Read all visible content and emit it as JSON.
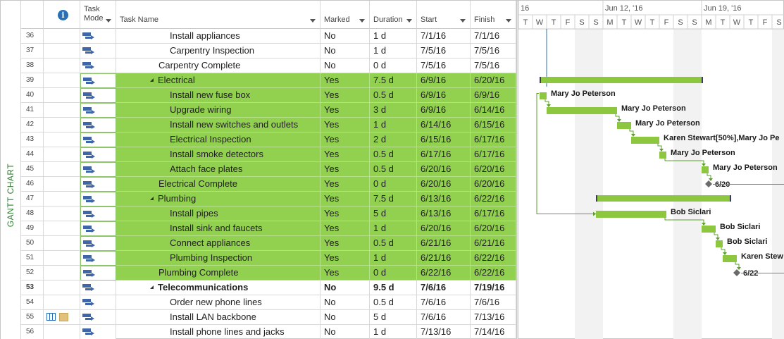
{
  "view": {
    "label": "GANTT CHART"
  },
  "columns": {
    "task_mode": "Task\nMode",
    "task_name": "Task Name",
    "marked": "Marked",
    "duration": "Duration",
    "start": "Start",
    "finish": "Finish"
  },
  "rows": [
    {
      "id": "36",
      "name": "Install appliances",
      "indent": 2,
      "marked": "No",
      "duration": "1 d",
      "start": "7/1/16",
      "finish": "7/1/16",
      "highlight": false,
      "summary": false
    },
    {
      "id": "37",
      "name": "Carpentry Inspection",
      "indent": 2,
      "marked": "No",
      "duration": "1 d",
      "start": "7/5/16",
      "finish": "7/5/16",
      "highlight": false,
      "summary": false
    },
    {
      "id": "38",
      "name": "Carpentry Complete",
      "indent": 1,
      "marked": "No",
      "duration": "0 d",
      "start": "7/5/16",
      "finish": "7/5/16",
      "highlight": false,
      "summary": false
    },
    {
      "id": "39",
      "name": "Electrical",
      "indent": 1,
      "marked": "Yes",
      "duration": "7.5 d",
      "start": "6/9/16",
      "finish": "6/20/16",
      "highlight": true,
      "summary": true,
      "bold": false
    },
    {
      "id": "40",
      "name": "Install new fuse box",
      "indent": 2,
      "marked": "Yes",
      "duration": "0.5 d",
      "start": "6/9/16",
      "finish": "6/9/16",
      "highlight": true,
      "summary": false
    },
    {
      "id": "41",
      "name": "Upgrade wiring",
      "indent": 2,
      "marked": "Yes",
      "duration": "3 d",
      "start": "6/9/16",
      "finish": "6/14/16",
      "highlight": true,
      "summary": false
    },
    {
      "id": "42",
      "name": "Install new switches and outlets",
      "indent": 2,
      "marked": "Yes",
      "duration": "1 d",
      "start": "6/14/16",
      "finish": "6/15/16",
      "highlight": true,
      "summary": false
    },
    {
      "id": "43",
      "name": "Electrical Inspection",
      "indent": 2,
      "marked": "Yes",
      "duration": "2 d",
      "start": "6/15/16",
      "finish": "6/17/16",
      "highlight": true,
      "summary": false
    },
    {
      "id": "44",
      "name": "Install smoke detectors",
      "indent": 2,
      "marked": "Yes",
      "duration": "0.5 d",
      "start": "6/17/16",
      "finish": "6/17/16",
      "highlight": true,
      "summary": false
    },
    {
      "id": "45",
      "name": "Attach face plates",
      "indent": 2,
      "marked": "Yes",
      "duration": "0.5 d",
      "start": "6/20/16",
      "finish": "6/20/16",
      "highlight": true,
      "summary": false
    },
    {
      "id": "46",
      "name": "Electrical Complete",
      "indent": 1,
      "marked": "Yes",
      "duration": "0 d",
      "start": "6/20/16",
      "finish": "6/20/16",
      "highlight": true,
      "summary": false
    },
    {
      "id": "47",
      "name": "Plumbing",
      "indent": 1,
      "marked": "Yes",
      "duration": "7.5 d",
      "start": "6/13/16",
      "finish": "6/22/16",
      "highlight": true,
      "summary": true,
      "bold": false
    },
    {
      "id": "48",
      "name": "Install pipes",
      "indent": 2,
      "marked": "Yes",
      "duration": "5 d",
      "start": "6/13/16",
      "finish": "6/17/16",
      "highlight": true,
      "summary": false
    },
    {
      "id": "49",
      "name": "Install sink and faucets",
      "indent": 2,
      "marked": "Yes",
      "duration": "1 d",
      "start": "6/20/16",
      "finish": "6/20/16",
      "highlight": true,
      "summary": false
    },
    {
      "id": "50",
      "name": "Connect appliances",
      "indent": 2,
      "marked": "Yes",
      "duration": "0.5 d",
      "start": "6/21/16",
      "finish": "6/21/16",
      "highlight": true,
      "summary": false
    },
    {
      "id": "51",
      "name": "Plumbing Inspection",
      "indent": 2,
      "marked": "Yes",
      "duration": "1 d",
      "start": "6/21/16",
      "finish": "6/22/16",
      "highlight": true,
      "summary": false
    },
    {
      "id": "52",
      "name": "Plumbing Complete",
      "indent": 1,
      "marked": "Yes",
      "duration": "0 d",
      "start": "6/22/16",
      "finish": "6/22/16",
      "highlight": true,
      "summary": false
    },
    {
      "id": "53",
      "name": "Telecommunications",
      "indent": 1,
      "marked": "No",
      "duration": "9.5 d",
      "start": "7/6/16",
      "finish": "7/19/16",
      "highlight": false,
      "summary": true,
      "bold": true
    },
    {
      "id": "54",
      "name": "Order new phone lines",
      "indent": 2,
      "marked": "No",
      "duration": "0.5 d",
      "start": "7/6/16",
      "finish": "7/6/16",
      "highlight": false,
      "summary": false
    },
    {
      "id": "55",
      "name": "Install LAN backbone",
      "indent": 2,
      "marked": "No",
      "duration": "5 d",
      "start": "7/6/16",
      "finish": "7/13/16",
      "highlight": false,
      "summary": false,
      "indicators": true
    },
    {
      "id": "56",
      "name": "Install phone lines and jacks",
      "indent": 2,
      "marked": "No",
      "duration": "1 d",
      "start": "7/13/16",
      "finish": "7/14/16",
      "highlight": false,
      "summary": false
    }
  ],
  "timescale": {
    "weeks": [
      {
        "label": "16",
        "day_index": -1
      },
      {
        "label": "Jun 12, '16",
        "day_index": 5
      },
      {
        "label": "Jun 19, '16",
        "day_index": 12
      }
    ],
    "days": [
      "T",
      "W",
      "T",
      "F",
      "S",
      "S",
      "M",
      "T",
      "W",
      "T",
      "F",
      "S",
      "S",
      "M",
      "T",
      "W",
      "T",
      "F",
      "S"
    ],
    "first_day": "6/7/16",
    "weekend_indices": [
      4,
      5,
      11,
      12,
      18
    ]
  },
  "gantt": {
    "bars": [
      {
        "row": 3,
        "type": "summary",
        "start_day": 1.5,
        "end_day": 13.1
      },
      {
        "row": 4,
        "type": "task",
        "start_day": 1.5,
        "end_day": 2.0,
        "label": "Mary Jo Peterson"
      },
      {
        "row": 5,
        "type": "task",
        "start_day": 2.0,
        "end_day": 7.0,
        "label": "Mary Jo Peterson"
      },
      {
        "row": 6,
        "type": "task",
        "start_day": 7.0,
        "end_day": 8.0,
        "label": "Mary Jo Peterson"
      },
      {
        "row": 7,
        "type": "task",
        "start_day": 8.0,
        "end_day": 10.0,
        "label": "Karen Stewart[50%],Mary Jo Pe"
      },
      {
        "row": 8,
        "type": "task",
        "start_day": 10.0,
        "end_day": 10.5,
        "label": "Mary Jo Peterson"
      },
      {
        "row": 9,
        "type": "task",
        "start_day": 13.0,
        "end_day": 13.5,
        "label": "Mary Jo Peterson"
      },
      {
        "row": 10,
        "type": "milestone",
        "start_day": 13.5,
        "label": "6/20"
      },
      {
        "row": 11,
        "type": "summary",
        "start_day": 5.5,
        "end_day": 15.1
      },
      {
        "row": 12,
        "type": "task",
        "start_day": 5.5,
        "end_day": 10.5,
        "label": "Bob Siclari"
      },
      {
        "row": 13,
        "type": "task",
        "start_day": 13.0,
        "end_day": 14.0,
        "label": "Bob Siclari"
      },
      {
        "row": 14,
        "type": "task",
        "start_day": 14.0,
        "end_day": 14.5,
        "label": "Bob Siclari"
      },
      {
        "row": 15,
        "type": "task",
        "start_day": 14.5,
        "end_day": 15.5,
        "label": "Karen Stew"
      },
      {
        "row": 16,
        "type": "milestone",
        "start_day": 15.5,
        "label": "6/22"
      }
    ],
    "colors": {
      "bar": "#8dc63f",
      "summary_end": "#3b3b5e",
      "milestone": "#6b6b6b",
      "link": "#5aa02c",
      "status_line": "#2a6fb5",
      "weekend": "#f2f2f2"
    }
  }
}
